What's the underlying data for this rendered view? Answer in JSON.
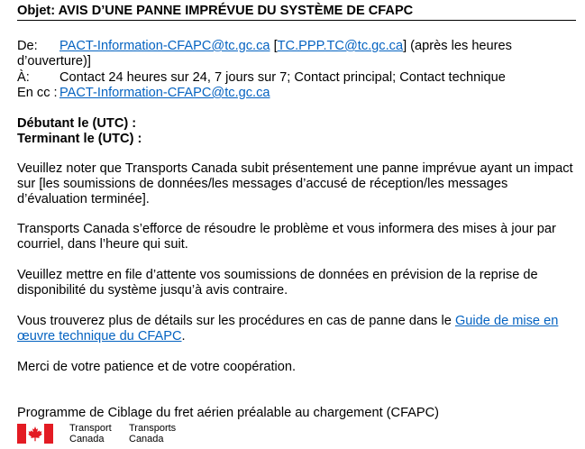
{
  "subject": {
    "text": "Objet: AVIS D’UNE PANNE IMPRÉVUE DU SYSTÈME DE CFAPC"
  },
  "header": {
    "from_label": "De:",
    "from_email": "PACT-Information-CFAPC@tc.gc.ca",
    "from_open_bracket": " [",
    "from_alt_email": "TC.PPP.TC@tc.gc.ca",
    "from_after_hours": "] (après les heures",
    "from_after_hours_line2": "d’ouverture)]",
    "to_label": "À:",
    "to_value": "Contact 24 heures sur 24, 7 jours sur 7; Contact principal; Contact technique",
    "cc_label": "En cc :",
    "cc_email": "PACT-Information-CFAPC@tc.gc.ca"
  },
  "times": {
    "start_label": "Débutant le (UTC) :",
    "end_label": "Terminant le (UTC) :"
  },
  "body": {
    "para1": "Veuillez noter que Transports Canada subit présentement une panne imprévue ayant un impact sur [les soumissions de données/les messages d’accusé de réception/les messages d’évaluation terminée].",
    "para2": "Transports Canada s’efforce de résoudre le problème et vous informera des mises à jour par courriel, dans l’heure qui suit.",
    "para3": "Veuillez mettre en file d’attente vos soumissions de données en prévision de la reprise de disponibilité du système jusqu’à avis contraire.",
    "para4_prefix": "Vous trouverez plus de détails sur les procédures en cas de panne dans le ",
    "para4_link": "Guide de mise en œuvre technique du CFAPC",
    "para4_suffix": ".",
    "para5": "Merci de votre patience et de votre coopération."
  },
  "signature": {
    "program": "Programme de Ciblage du fret aérien préalable au chargement (CFAPC)",
    "dept_en_line1": "Transport",
    "dept_en_line2": "Canada",
    "dept_fr_line1": "Transports",
    "dept_fr_line2": "Canada"
  },
  "colors": {
    "link": "#0563c1",
    "flag_red": "#e31b23"
  }
}
